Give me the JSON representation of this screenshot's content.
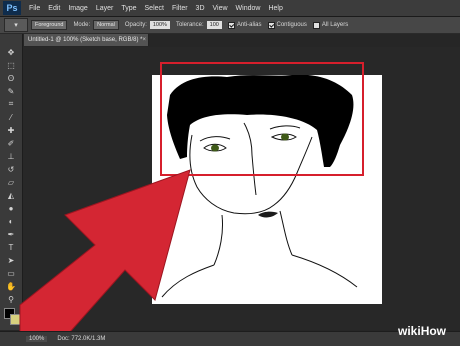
{
  "app": {
    "logo": "Ps"
  },
  "menu": [
    "File",
    "Edit",
    "Image",
    "Layer",
    "Type",
    "Select",
    "Filter",
    "3D",
    "View",
    "Window",
    "Help"
  ],
  "options": {
    "sample_value": "Foreground",
    "mode_label": "Mode:",
    "mode_value": "Normal",
    "opacity_label": "Opacity:",
    "opacity_value": "100%",
    "tolerance_label": "Tolerance:",
    "tolerance_value": "100",
    "antialias_label": "Anti-alias",
    "contiguous_label": "Contiguous",
    "all_layers_label": "All Layers"
  },
  "document": {
    "tab_title": "Untitled-1 @ 100% (Sketch base, RGB/8) *",
    "close": "×"
  },
  "status": {
    "zoom": "100%",
    "doc_size": "Doc: 772.0K/1.3M"
  },
  "tools": [
    "move-icon",
    "marquee-icon",
    "lasso-icon",
    "quick-select-icon",
    "crop-icon",
    "eyedropper-icon",
    "healing-icon",
    "brush-icon",
    "stamp-icon",
    "history-brush-icon",
    "eraser-icon",
    "paint-bucket-icon",
    "blur-icon",
    "dodge-icon",
    "pen-icon",
    "type-icon",
    "path-select-icon",
    "shape-icon",
    "hand-icon",
    "zoom-icon"
  ],
  "watermark": {
    "wiki": "wiki",
    "how": "How"
  },
  "colors": {
    "arrow": "#d42633",
    "selection_box": "#d61f2c",
    "foreground_swatch": "#000000",
    "background_swatch": "#d8d17f"
  }
}
